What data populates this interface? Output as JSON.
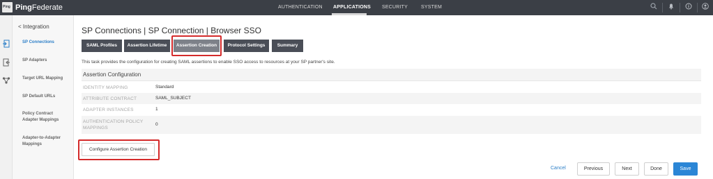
{
  "topbar": {
    "logo_text": "Ping",
    "brand_bold": "Ping",
    "brand_rest": "Federate",
    "nav": [
      {
        "label": "AUTHENTICATION",
        "active": false
      },
      {
        "label": "APPLICATIONS",
        "active": true
      },
      {
        "label": "SECURITY",
        "active": false
      },
      {
        "label": "SYSTEM",
        "active": false
      }
    ],
    "icons": [
      "search-icon",
      "bell-icon",
      "help-icon",
      "user-icon"
    ]
  },
  "sidebar": {
    "back_label": "< Integration",
    "items": [
      {
        "label": "SP Connections",
        "active": true
      },
      {
        "label": "SP Adapters",
        "active": false
      },
      {
        "label": "Target URL Mapping",
        "active": false
      },
      {
        "label": "SP Default URLs",
        "active": false
      },
      {
        "label": "Policy Contract Adapter Mappings",
        "active": false
      },
      {
        "label": "Adapter-to-Adapter Mappings",
        "active": false
      }
    ]
  },
  "main": {
    "title": "SP Connections | SP Connection | Browser SSO",
    "tabs": [
      {
        "label": "SAML Profiles",
        "active": false
      },
      {
        "label": "Assertion Lifetime",
        "active": false
      },
      {
        "label": "Assertion Creation",
        "active": true
      },
      {
        "label": "Protocol Settings",
        "active": false
      },
      {
        "label": "Summary",
        "active": false
      }
    ],
    "description": "This task provides the configuration for creating SAML assertions to enable SSO access to resources at your SP partner's site.",
    "panel_title": "Assertion Configuration",
    "rows": [
      {
        "label": "IDENTITY MAPPING",
        "value": "Standard"
      },
      {
        "label": "ATTRIBUTE CONTRACT",
        "value": "SAML_SUBJECT"
      },
      {
        "label": "ADAPTER INSTANCES",
        "value": "1"
      },
      {
        "label": "AUTHENTICATION POLICY MAPPINGS",
        "value": "0"
      }
    ],
    "configure_button": "Configure Assertion Creation"
  },
  "footer": {
    "cancel": "Cancel",
    "previous": "Previous",
    "next": "Next",
    "done": "Done",
    "save": "Save"
  },
  "colors": {
    "topbar": "#3b3f46",
    "accent": "#2b86d6",
    "highlight": "#d42a2a",
    "tab": "#4a4e57",
    "tab_active": "#7d8189"
  }
}
